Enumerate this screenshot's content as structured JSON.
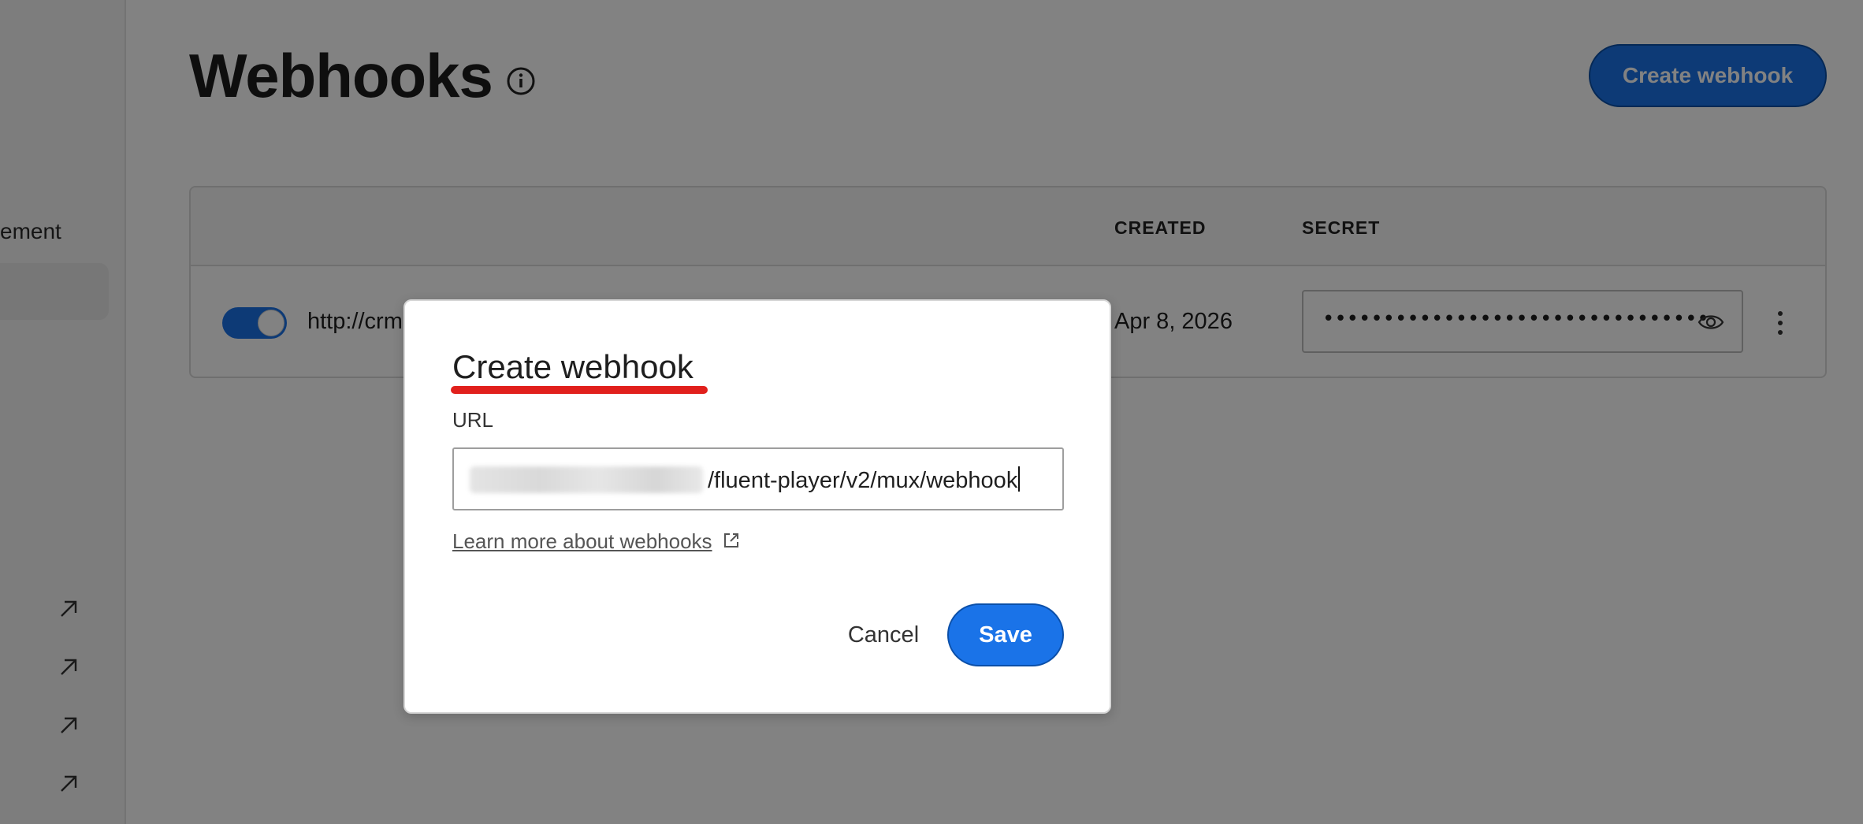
{
  "sidebar": {
    "partial_label": "ement",
    "links": [
      {
        "icon": "arrow-up-right-icon"
      },
      {
        "icon": "arrow-up-right-icon"
      },
      {
        "icon": "arrow-up-right-icon"
      },
      {
        "icon": "arrow-up-right-icon"
      }
    ]
  },
  "header": {
    "title": "Webhooks",
    "info_icon": "info-icon",
    "create_button": "Create webhook"
  },
  "table": {
    "columns": [
      "CREATED",
      "SECRET"
    ],
    "rows": [
      {
        "enabled": true,
        "url_partial": "http://crm",
        "created": "Apr 8, 2026",
        "secret_masked": "••••••••••••••••••••••••••••••••"
      }
    ]
  },
  "dialog": {
    "title": "Create webhook",
    "url_label": "URL",
    "url_value_visible": "/fluent-player/v2/mux/webhook",
    "learn_more": "Learn more about webhooks",
    "cancel": "Cancel",
    "save": "Save"
  },
  "colors": {
    "primary": "#1a73e8",
    "accent_underline": "#e1201c",
    "overlay": "rgba(0,0,0,0.49)"
  }
}
